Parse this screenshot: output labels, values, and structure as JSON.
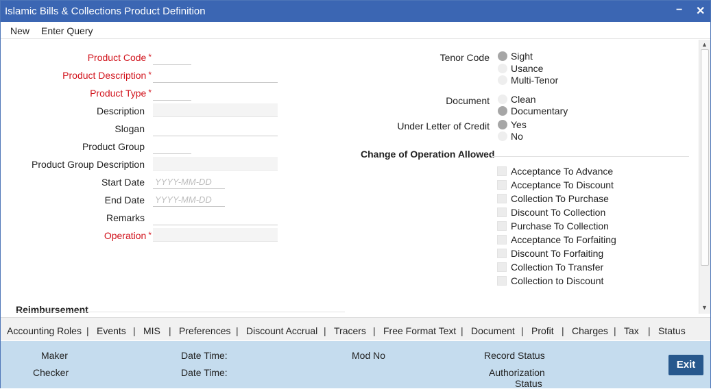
{
  "window": {
    "title": "Islamic Bills & Collections Product Definition",
    "minimize_glyph": "−",
    "close_glyph": "✕"
  },
  "menu": {
    "new": "New",
    "enter_query": "Enter Query"
  },
  "form": {
    "product_code": {
      "label": "Product Code",
      "value": ""
    },
    "product_description": {
      "label": "Product Description",
      "value": ""
    },
    "product_type": {
      "label": "Product Type",
      "value": ""
    },
    "description": {
      "label": "Description",
      "value": ""
    },
    "slogan": {
      "label": "Slogan",
      "value": ""
    },
    "product_group": {
      "label": "Product Group",
      "value": ""
    },
    "product_group_description": {
      "label": "Product Group Description",
      "value": ""
    },
    "start_date": {
      "label": "Start Date",
      "placeholder": "YYYY-MM-DD"
    },
    "end_date": {
      "label": "End Date",
      "placeholder": "YYYY-MM-DD"
    },
    "remarks": {
      "label": "Remarks",
      "value": ""
    },
    "operation": {
      "label": "Operation",
      "value": ""
    },
    "required_mark": "*"
  },
  "tenor": {
    "label": "Tenor Code",
    "options": [
      "Sight",
      "Usance",
      "Multi-Tenor"
    ],
    "selected": "Sight"
  },
  "document": {
    "label": "Document",
    "options": [
      "Clean",
      "Documentary"
    ],
    "selected": "Documentary"
  },
  "loc": {
    "label": "Under Letter of Credit",
    "options": [
      "Yes",
      "No"
    ],
    "selected": "Yes"
  },
  "change_of_operation": {
    "title": "Change of Operation Allowed",
    "items": [
      "Acceptance To Advance",
      "Acceptance To Discount",
      "Collection To Purchase",
      "Discount To Collection",
      "Purchase To Collection",
      "Acceptance To Forfaiting",
      "Discount To Forfaiting",
      "Collection To Transfer",
      "Collection to Discount"
    ]
  },
  "reimbursement": {
    "title": "Reimbursement"
  },
  "tabs": [
    "Accounting Roles",
    "Events",
    "MIS",
    "Preferences",
    "Discount Accrual",
    "Tracers",
    "Free Format Text",
    "Document",
    "Profit",
    "Charges",
    "Tax",
    "Status"
  ],
  "tab_separator": "|",
  "footer": {
    "maker": "Maker",
    "checker": "Checker",
    "date_time_1": "Date Time:",
    "date_time_2": "Date Time:",
    "mod_no": "Mod No",
    "record_status": "Record Status",
    "authorization_status_1": "Authorization",
    "authorization_status_2": "Status",
    "exit": "Exit"
  },
  "colors": {
    "titlebar": "#3b66b3",
    "required": "#d1121b",
    "footer": "#c5dcee",
    "exit_button": "#27588d"
  }
}
